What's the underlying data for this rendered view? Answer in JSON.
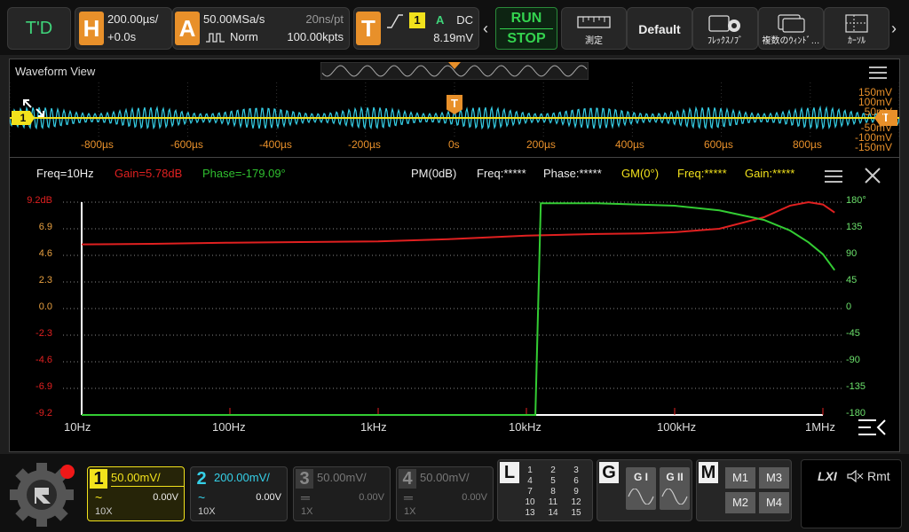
{
  "topbar": {
    "td_label": "T'D",
    "horizontal": {
      "letter": "H",
      "timebase": "200.00µs/",
      "offset": "+0.0s"
    },
    "acquire": {
      "letter": "A",
      "sample_rate": "50.00MSa/s",
      "time_per_pt": "20ns/pt",
      "mode": "Norm",
      "memory": "100.00kpts"
    },
    "trigger": {
      "letter": "T",
      "source": "1",
      "mode": "A",
      "coupling": "DC",
      "level": "8.19mV"
    },
    "run_label": "RUN",
    "stop_label": "STOP",
    "buttons": {
      "measure": "測定",
      "default": "Default",
      "flex": "ﾌﾚｯｸｽﾉﾌﾞ",
      "multi_window": "複数のｳｨﾝﾄﾞ…",
      "cursor": "ｶｰｿﾙ"
    }
  },
  "waveform_view": {
    "title": "Waveform View",
    "ticks": [
      "-800µs",
      "-600µs",
      "-400µs",
      "-200µs",
      "0s",
      "200µs",
      "400µs",
      "600µs",
      "800µs"
    ],
    "right_labels": [
      "150mV",
      "100mV",
      "50mV",
      "0mV",
      "-50mV",
      "-100mV",
      "-150mV"
    ],
    "ch1_marker": "1",
    "trigger_marker": "T"
  },
  "bode": {
    "freq_readout": "Freq=10Hz",
    "gain_readout": "Gain=5.78dB",
    "phase_readout": "Phase=-179.09°",
    "pm_label": "PM(0dB)",
    "pm_freq": "Freq:*****",
    "pm_phase": "Phase:*****",
    "gm_label": "GM(0°)",
    "gm_freq": "Freq:*****",
    "gm_gain": "Gain:*****",
    "gain_axis": [
      "9.2dB",
      "6.9",
      "4.6",
      "2.3",
      "0.0",
      "-2.3",
      "-4.6",
      "-6.9",
      "-9.2"
    ],
    "phase_axis": [
      "180°",
      "135",
      "90",
      "45",
      "0",
      "-45",
      "-90",
      "-135",
      "-180"
    ],
    "freq_axis": [
      "10Hz",
      "100Hz",
      "1kHz",
      "10kHz",
      "100kHz",
      "1MHz"
    ],
    "colors": {
      "gain": "#e02020",
      "phase": "#33cc33"
    }
  },
  "channels": [
    {
      "num": "1",
      "scale": "50.00mV/",
      "offset": "0.00V",
      "probe": "10X",
      "coupling": "~",
      "active": true
    },
    {
      "num": "2",
      "scale": "200.00mV/",
      "offset": "0.00V",
      "probe": "10X",
      "coupling": "~",
      "active": true
    },
    {
      "num": "3",
      "scale": "50.00mV/",
      "offset": "0.00V",
      "probe": "1X",
      "coupling": "═",
      "active": false
    },
    {
      "num": "4",
      "scale": "50.00mV/",
      "offset": "0.00V",
      "probe": "1X",
      "coupling": "═",
      "active": false
    }
  ],
  "logic": {
    "letter": "L",
    "numbers": [
      "1",
      "2",
      "3",
      "4",
      "5",
      "6",
      "7",
      "8",
      "9",
      "10",
      "11",
      "12",
      "13",
      "14",
      "15"
    ]
  },
  "generator": {
    "letter": "G",
    "g1": "G I",
    "g2": "G II"
  },
  "math": {
    "letter": "M",
    "m1": "M1",
    "m2": "M2",
    "m3": "M3",
    "m4": "M4"
  },
  "status": {
    "lxi": "LXI",
    "remote": "Rmt"
  }
}
